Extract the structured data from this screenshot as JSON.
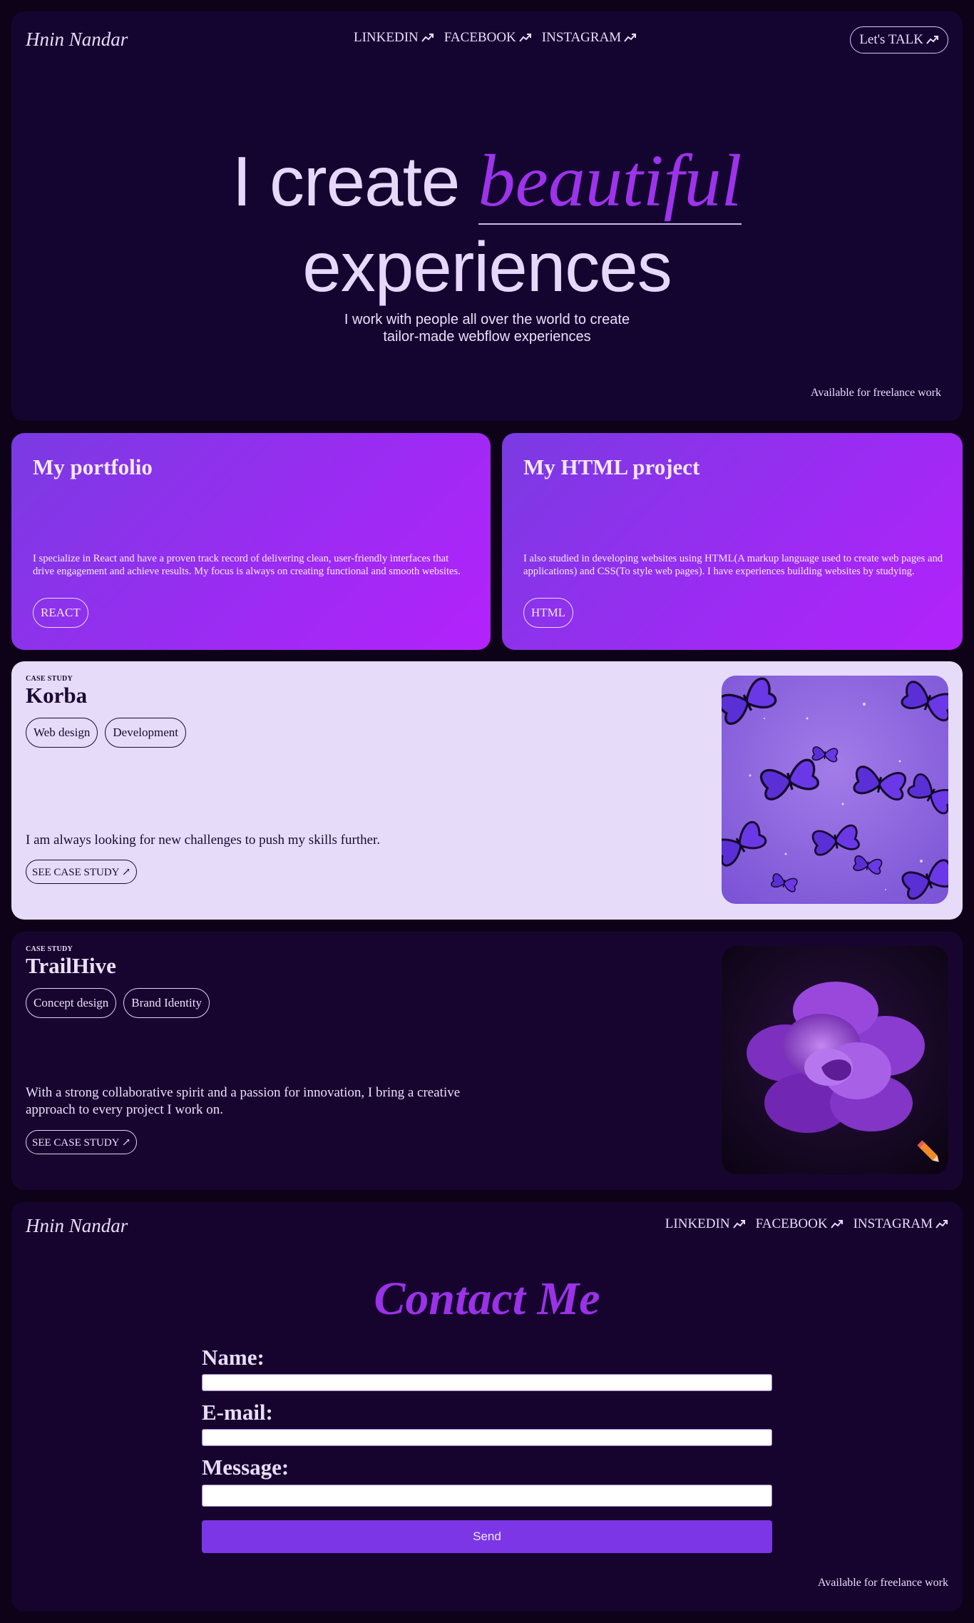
{
  "header": {
    "brand": "Hnin Nandar",
    "nav": [
      "LINKEDIN",
      "FACEBOOK",
      "INSTAGRAM"
    ],
    "cta": "Let's TALK"
  },
  "hero": {
    "line1_start": "I create ",
    "line1_accent": "beautiful",
    "line2": "experiences",
    "subtitle_1": "I work with people all over the world to create",
    "subtitle_2": "tailor-made webflow experiences",
    "availability": "Available for freelance work"
  },
  "cards": [
    {
      "title": "My portfolio",
      "text": "I specialize in React and have a proven track record of delivering clean, user-friendly interfaces that drive engagement and achieve results. My focus is always on creating functional and smooth websites.",
      "tag": "REACT"
    },
    {
      "title": "My HTML project",
      "text": "I also studied in developing websites using HTML(A markup language used to create web pages and applications) and CSS(To style web pages). I have experiences building websites by studying.",
      "tag": "HTML"
    }
  ],
  "cases": [
    {
      "eyebrow": "CASE STUDY",
      "title": "Korba",
      "tags": [
        "Web design",
        "Development"
      ],
      "description": "I am always looking for new challenges to push my skills further.",
      "button": "SEE CASE STUDY ↗",
      "image": "purple-butterflies-image"
    },
    {
      "eyebrow": "CASE STUDY",
      "title": "TrailHive",
      "tags": [
        "Concept design",
        "Brand Identity"
      ],
      "description": "With a strong collaborative spirit and a passion for innovation, I bring a creative approach to every project I work on.",
      "button": "SEE CASE STUDY ↗",
      "image": "purple-flower-image"
    }
  ],
  "contact": {
    "brand": "Hnin Nandar",
    "nav": [
      "LINKEDIN",
      "FACEBOOK",
      "INSTAGRAM"
    ],
    "title": "Contact Me",
    "name_label": "Name:",
    "email_label": "E-mail:",
    "message_label": "Message:",
    "send": "Send",
    "availability": "Available for freelance work"
  },
  "colors": {
    "background": "#0d0218",
    "panel": "#140530",
    "accent": "#9d33eb",
    "card_gradient_start": "#7a3be2",
    "card_gradient_end": "#b322fb",
    "light_card": "#e6dcfa",
    "button": "#7c36e6"
  }
}
